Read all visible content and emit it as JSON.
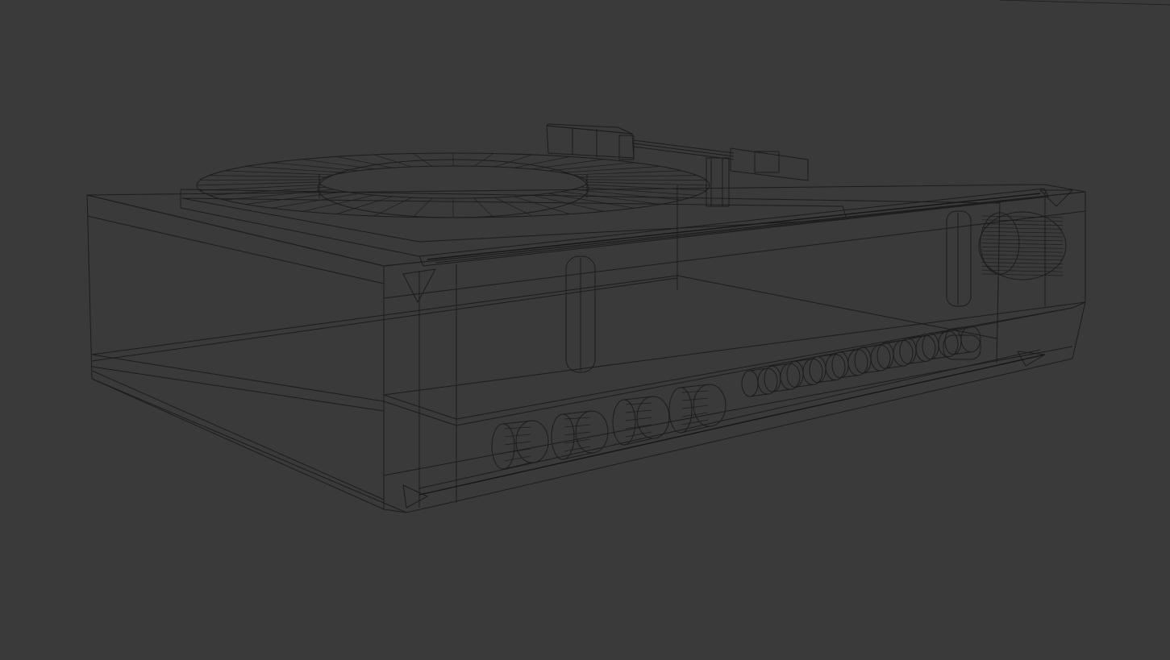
{
  "viewport": {
    "background_color": "#3a3a3a",
    "wire_color": "#1c1c1c",
    "render_mode": "wireframe",
    "model": "turntable-receiver"
  }
}
